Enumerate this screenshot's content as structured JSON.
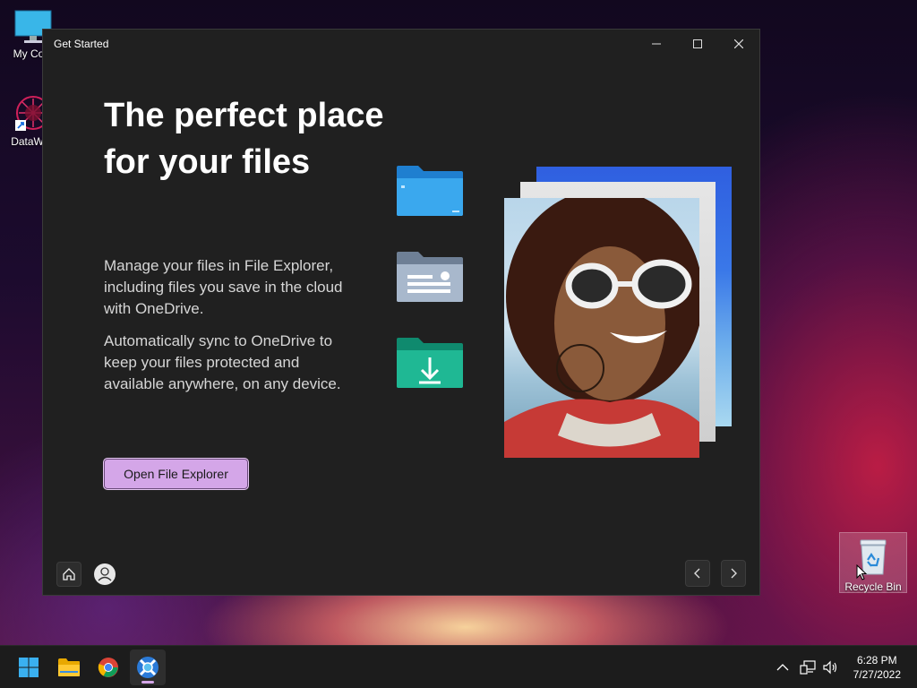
{
  "desktop": {
    "icons": [
      {
        "label": "My Com"
      },
      {
        "label": "DataWag"
      },
      {
        "label": "Recycle Bin"
      }
    ]
  },
  "window": {
    "title": "Get Started",
    "headline": "The perfect place for your files",
    "paragraph1": "Manage your files in File Explorer, including files you save in the cloud with OneDrive.",
    "paragraph2": "Automatically sync to OneDrive to keep your files protected and available anywhere, on any device.",
    "primary_button": "Open File Explorer",
    "controls": {
      "minimize": "minimize-icon",
      "maximize": "maximize-icon",
      "close": "close-icon"
    },
    "nav": {
      "home": "home-icon",
      "profile": "person-icon",
      "prev": "chevron-left-icon",
      "next": "chevron-right-icon"
    }
  },
  "taskbar": {
    "items": [
      "windows-start-icon",
      "file-explorer-icon",
      "chrome-icon",
      "get-started-icon"
    ],
    "tray": [
      "chevron-up-icon",
      "network-icon",
      "volume-icon"
    ],
    "time": "6:28 PM",
    "date": "7/27/2022"
  },
  "colors": {
    "accent": "#d4a6e8",
    "window_bg": "#202020",
    "taskbar_bg": "#1c1c1c"
  }
}
